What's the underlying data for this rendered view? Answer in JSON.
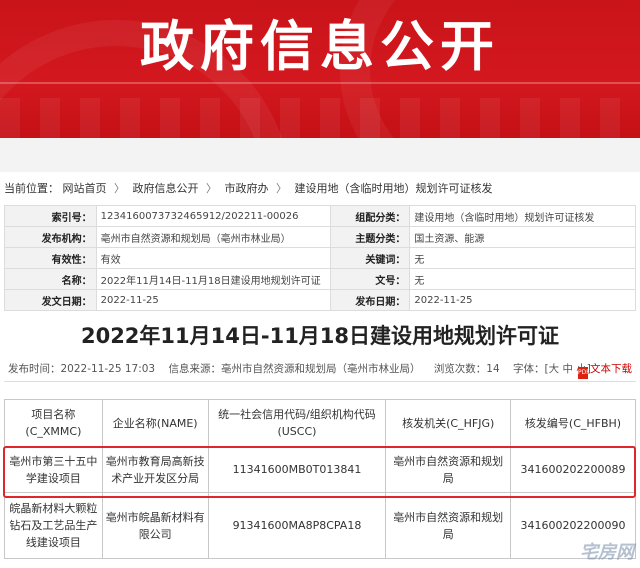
{
  "banner": {
    "title": "政府信息公开"
  },
  "breadcrumb": {
    "prefix": "当前位置：",
    "items": [
      "网站首页",
      "政府信息公开",
      "市政府办",
      "建设用地（含临时用地）规划许可证核发"
    ],
    "separator": "〉"
  },
  "meta": {
    "rows": [
      {
        "k1": "索引号：",
        "v1": "1234160073732465912/202211-00026",
        "k2": "组配分类：",
        "v2": "建设用地（含临时用地）规划许可证核发"
      },
      {
        "k1": "发布机构：",
        "v1": "亳州市自然资源和规划局（亳州市林业局）",
        "k2": "主题分类：",
        "v2": "国土资源、能源"
      },
      {
        "k1": "有效性：",
        "v1": "有效",
        "k2": "关键词：",
        "v2": "无"
      },
      {
        "k1": "名称：",
        "v1": "2022年11月14日-11月18日建设用地规划许可证",
        "k2": "文号：",
        "v2": "无"
      },
      {
        "k1": "发文日期：",
        "v1": "2022-11-25",
        "k2": "发布日期：",
        "v2": "2022-11-25"
      }
    ]
  },
  "article": {
    "title": "2022年11月14日-11月18日建设用地规划许可证",
    "publish_time": "发布时间：2022-11-25 17:03",
    "source": "信息来源：亳州市自然资源和规划局（亳州市林业局）",
    "views": "浏览次数：14",
    "font_size": "字体：[大 中 小]",
    "download": "文本下载",
    "pdf_icon_text": "PDF"
  },
  "table": {
    "headers": [
      "项目名称(C_XMMC)",
      "企业名称(NAME)",
      "统一社会信用代码/组织机构代码(USCC)",
      "核发机关(C_HFJG)",
      "核发编号(C_HFBH)"
    ],
    "rows": [
      [
        "亳州市第三十五中学建设项目",
        "亳州市教育局高新技术产业开发区分局",
        "11341600MB0T013841",
        "亳州市自然资源和规划局",
        "341600202200089"
      ],
      [
        "皖晶新材料大颗粒钻石及工艺品生产线建设项目",
        "亳州市皖晶新材料有限公司",
        "91341600MA8P8CPA18",
        "亳州市自然资源和规划局",
        "341600202200090"
      ]
    ]
  },
  "watermark": "宅房网",
  "colors": {
    "banner_red": "#d3181e",
    "highlight": "#e0262d",
    "link_red": "#cc0000"
  }
}
